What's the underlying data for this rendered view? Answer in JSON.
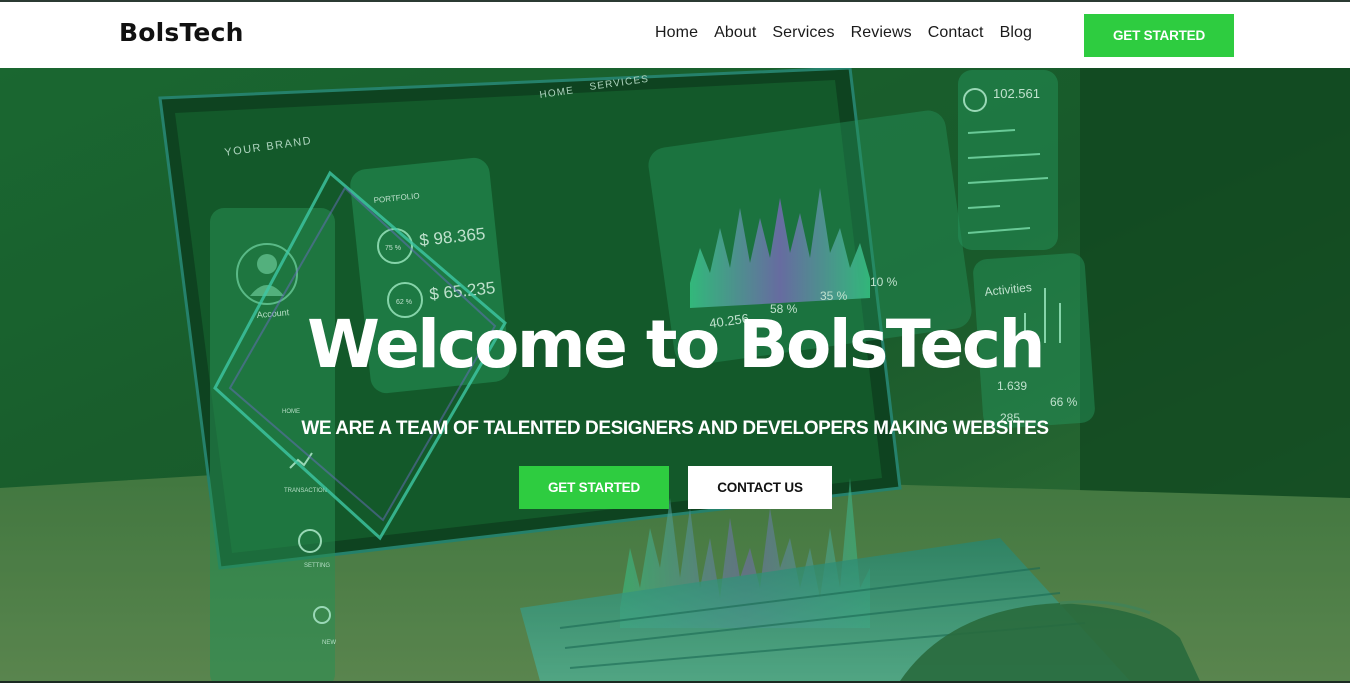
{
  "header": {
    "logo": "BolsTech",
    "nav": [
      "Home",
      "About",
      "Services",
      "Reviews",
      "Contact",
      "Blog"
    ],
    "cta_label": "GET STARTED"
  },
  "hero": {
    "title": "Welcome to BolsTech",
    "subtitle": "WE ARE A TEAM OF TALENTED DESIGNERS AND DEVELOPERS MAKING WEBSITES",
    "primary_button": "GET STARTED",
    "secondary_button": "CONTACT US"
  },
  "background_screen": {
    "brand": "YOUR BRAND",
    "menu": [
      "HOME",
      "SERVICES"
    ],
    "portfolio_label": "PORTFOLIO",
    "account_label": "Account",
    "portfolio_values": [
      "$ 98.365",
      "$ 65.235"
    ],
    "portfolio_percents": [
      "75 %",
      "62 %"
    ],
    "stat_counter": "102.561",
    "stat_percents": [
      "58 %",
      "35 %",
      "10 %"
    ],
    "activities_label": "Activities",
    "activities_values": [
      "1.639",
      "66 %",
      "285"
    ],
    "sidebar_items": [
      "HOME",
      "TRANSACTION",
      "SETTING",
      "NEW"
    ],
    "side_value": "40.256"
  },
  "colors": {
    "accent": "#2ecc40",
    "header_bg": "#ffffff",
    "overlay": "#0f5a26"
  }
}
